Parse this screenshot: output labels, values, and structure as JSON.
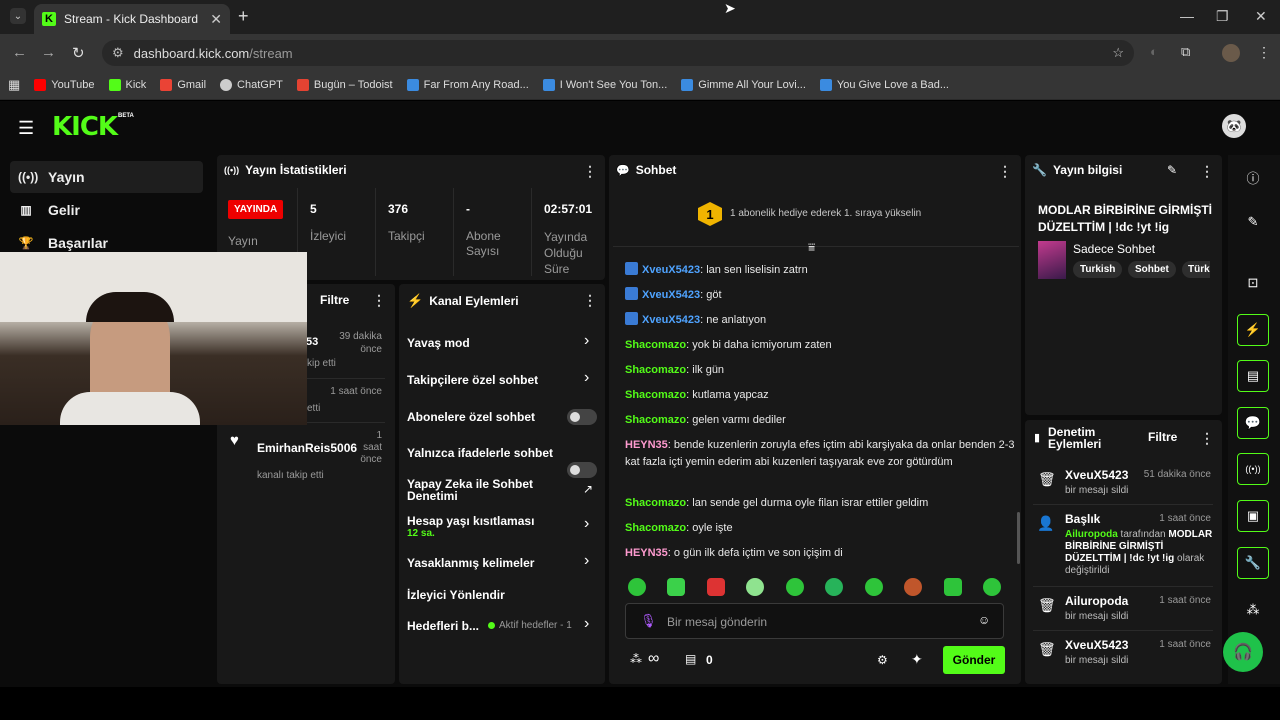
{
  "browser": {
    "tab_title": "Stream - Kick Dashboard",
    "tab_icon": "K",
    "url_host": "dashboard.kick.com",
    "url_path": "/stream",
    "bookmarks": [
      {
        "label": "YouTube",
        "color": "#ff0000"
      },
      {
        "label": "Kick",
        "color": "#53fc18"
      },
      {
        "label": "Gmail",
        "color": "#ea4335"
      },
      {
        "label": "ChatGPT",
        "color": "#cccccc"
      },
      {
        "label": "Bugün – Todoist",
        "color": "#e44332"
      },
      {
        "label": "Far From Any Road...",
        "color": "#3b8be0"
      },
      {
        "label": "I Won't See You Ton...",
        "color": "#3b8be0"
      },
      {
        "label": "Gimme All Your Lovi...",
        "color": "#3b8be0"
      },
      {
        "label": "You Give Love a Bad...",
        "color": "#3b8be0"
      }
    ]
  },
  "app": {
    "logo": "KICK",
    "beta": "BETA",
    "accent": "#53fc18",
    "nav": [
      {
        "label": "Yayın",
        "icon": "broadcast-icon"
      },
      {
        "label": "Gelir",
        "icon": "chart-icon"
      },
      {
        "label": "Başarılar",
        "icon": "trophy-icon"
      }
    ]
  },
  "stats": {
    "title": "Yayın İstatistikleri",
    "live_badge": "YAYINDA",
    "live_label": "Yayın",
    "viewers_value": "5",
    "viewers_label": "İzleyici",
    "followers_value": "376",
    "followers_label": "Takipçi",
    "subs_value": "-",
    "subs_label": "Abone Sayısı",
    "uptime_value": "02:57:01",
    "uptime_label": "Yayında Olduğu Süre"
  },
  "activity": {
    "filter_label": "Filtre",
    "items": [
      {
        "fragment": "53",
        "time": "39 dakika önce",
        "action": "kip etti"
      },
      {
        "time": "1 saat önce",
        "action": "etti"
      },
      {
        "user": "EmirhanReis5006",
        "time": "1 saat önce",
        "action": "kanalı takip etti"
      }
    ]
  },
  "channel_actions": {
    "title": "Kanal Eylemleri",
    "items": [
      {
        "label": "Yavaş mod"
      },
      {
        "label": "Takipçilere özel sohbet"
      },
      {
        "label": "Abonelere özel sohbet"
      },
      {
        "label": "Yalnızca ifadelerle sohbet"
      },
      {
        "label": "Yapay Zeka ile Sohbet Denetimi"
      },
      {
        "label": "Hesap yaşı kısıtlaması",
        "sub": "12 sa."
      },
      {
        "label": "Yasaklanmış kelimeler"
      },
      {
        "label": "İzleyici Yönlendir"
      },
      {
        "label": "Hedefleri b...",
        "sub": "Aktif hedefler - 1"
      }
    ]
  },
  "chat": {
    "title": "Sohbet",
    "gift_badge": "1",
    "gift_text": "1 abonelik hediye ederek 1. sıraya yükselin",
    "messages": [
      {
        "user": "XveuX5423",
        "text": ": lan sen liselisin zatrn",
        "color": "#4fa3ff"
      },
      {
        "user": "XveuX5423",
        "text": ": göt",
        "color": "#4fa3ff"
      },
      {
        "user": "XveuX5423",
        "text": ": ne anlatıyon",
        "color": "#4fa3ff"
      },
      {
        "user": "Shacomazo",
        "text": ": yok bi daha icmiyorum zaten",
        "color": "#53fc18"
      },
      {
        "user": "Shacomazo",
        "text": ": ilk gün",
        "color": "#53fc18"
      },
      {
        "user": "Shacomazo",
        "text": ": kutlama yapcaz",
        "color": "#53fc18"
      },
      {
        "user": "Shacomazo",
        "text": ": gelen varmı dediler",
        "color": "#53fc18"
      },
      {
        "user": "HEYN35",
        "text": ": bende kuzenlerin zoruyla efes içtim abi karşiyaka da onlar benden 2-3 kat fazla içti yemin ederim abi kuzenleri taşıyarak eve zor götürdüm",
        "color": "#ff9bd0"
      },
      {
        "user": "Shacomazo",
        "text": ": lan sende gel durma oyle filan israr ettiler geldim",
        "color": "#53fc18"
      },
      {
        "user": "Shacomazo",
        "text": ": oyle işte",
        "color": "#53fc18"
      },
      {
        "user": "HEYN35",
        "text": ": o gün ilk defa içtim ve son içişim di",
        "color": "#ff9bd0"
      }
    ],
    "input_placeholder": "Bir mesaj gönderin",
    "infinity": "∞",
    "gift_count": "0",
    "send_label": "Gönder"
  },
  "stream_info": {
    "title": "Yayın bilgisi",
    "stream_title": "MODLAR BİRBİRİNE GİRMİŞTİ DÜZELTTİM | !dc !yt !ig",
    "category": "Sadece Sohbet",
    "tags": [
      "Turkish",
      "Sohbet",
      "Türk"
    ]
  },
  "moderation": {
    "title": "Denetim Eylemleri",
    "filter_label": "Filtre",
    "items": [
      {
        "user": "XveuX5423",
        "time": "51 dakika önce",
        "action": "bir mesajı sildi",
        "icon": "trash-icon"
      },
      {
        "user": "Başlık",
        "time": "1 saat önce",
        "by": "Ailuropoda",
        "by_suffix": " tarafından",
        "new_title": "MODLAR BİRBİRİNE GİRMİŞTİ DÜZELTTİM | !dc !yt !ig",
        "action": " olarak değiştirildi",
        "icon": "user-edit-icon"
      },
      {
        "user": "Ailuropoda",
        "time": "1 saat önce",
        "action": "bir mesajı sildi",
        "icon": "trash-icon"
      },
      {
        "user": "XveuX5423",
        "time": "1 saat önce",
        "action": "bir mesajı sildi",
        "icon": "trash-icon"
      }
    ]
  }
}
